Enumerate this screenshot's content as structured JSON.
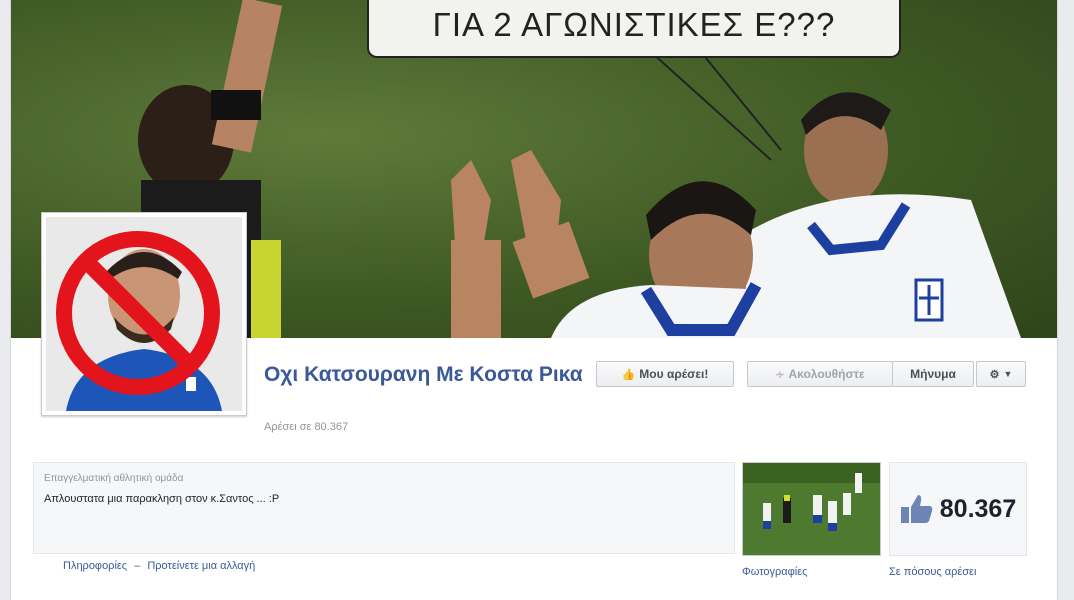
{
  "cover": {
    "speech_text": "ΓΙΑ 2 ΑΓΩΝΙΣΤΙΚΕΣ Ε???"
  },
  "page": {
    "title": "Οχι Κατσουρανη Με Κοστα Ρικα",
    "likes_subtitle": "Αρέσει σε 80.367",
    "category": "Επαγγελματική αθλητική ομάδα",
    "description": "Απλουστατα μια παρακληση στον κ.Σαντος ... :P"
  },
  "actions": {
    "like_label": "Μου αρέσει!",
    "follow_label": "Ακολουθήστε",
    "message_label": "Μήνυμα"
  },
  "links": {
    "info": "Πληροφορίες",
    "separator": "–",
    "suggest": "Προτείνετε μια αλλαγή"
  },
  "sections": {
    "photos_label": "Φωτογραφίες",
    "likes_count": "80.367",
    "likes_label": "Σε πόσους αρέσει"
  },
  "colors": {
    "brand_blue": "#3b5998",
    "no_sign_red": "#e3141b"
  },
  "icons": {
    "like": "thumbs-up-icon",
    "follow": "rss-icon",
    "settings": "gear-icon",
    "dropdown": "caret-down-icon"
  }
}
